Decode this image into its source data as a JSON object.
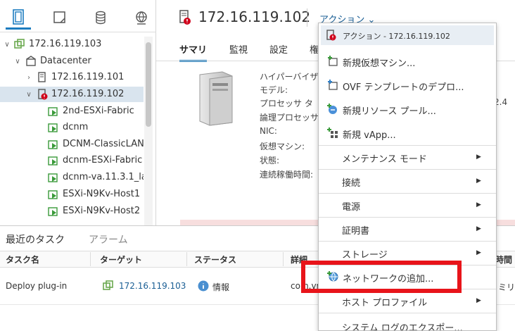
{
  "window": {
    "title": "172.16.119.102",
    "actions_label": "アクション ⌄"
  },
  "nav": {
    "tree": [
      {
        "label": "172.16.119.103",
        "type": "vcenter",
        "expanded": true,
        "depth": 0
      },
      {
        "label": "Datacenter",
        "type": "datacenter",
        "expanded": true,
        "depth": 1
      },
      {
        "label": "172.16.119.101",
        "type": "host",
        "expanded": false,
        "depth": 2
      },
      {
        "label": "172.16.119.102",
        "type": "host-alert",
        "expanded": true,
        "depth": 2,
        "selected": true
      },
      {
        "label": "2nd-ESXi-Fabric",
        "type": "vm",
        "depth": 3
      },
      {
        "label": "dcnm",
        "type": "vm",
        "depth": 3
      },
      {
        "label": "DCNM-ClassicLAN",
        "type": "vm",
        "depth": 3
      },
      {
        "label": "dcnm-ESXi-Fabric",
        "type": "vm",
        "depth": 3
      },
      {
        "label": "dcnm-va.11.3.1_la...",
        "type": "vm",
        "depth": 3
      },
      {
        "label": "ESXi-N9Kv-Host1",
        "type": "vm",
        "depth": 3
      },
      {
        "label": "ESXi-N9Kv-Host2",
        "type": "vm",
        "depth": 3
      }
    ]
  },
  "main": {
    "tabs": [
      "サマリ",
      "監視",
      "設定",
      "権"
    ],
    "summary_labels": [
      "ハイパーバイザ",
      "モデル:",
      "プロセッサ タ",
      "論理プロセッサ",
      "NIC:",
      "仮想マシン:",
      "状態:",
      "連続稼働時間:"
    ],
    "extra_value": "2.4"
  },
  "menu": {
    "header": "アクション - 172.16.119.102",
    "items": [
      {
        "label": "新規仮想マシン...",
        "icon": "new-vm-icon",
        "submenu": false
      },
      {
        "label": "OVF テンプレートのデプロ...",
        "icon": "deploy-ovf-icon",
        "submenu": false
      },
      {
        "label": "新規リソース プール...",
        "icon": "resource-pool-icon",
        "submenu": false
      },
      {
        "label": "新規 vApp...",
        "icon": "vapp-icon",
        "submenu": false
      },
      {
        "label": "メンテナンス モード",
        "submenu": true
      },
      {
        "label": "接続",
        "submenu": true
      },
      {
        "label": "電源",
        "submenu": true
      },
      {
        "label": "証明書",
        "submenu": true
      },
      {
        "label": "ストレージ",
        "submenu": true
      },
      {
        "label": "ネットワークの追加...",
        "icon": "add-network-icon",
        "submenu": false,
        "highlighted": true
      },
      {
        "label": "ホスト プロファイル",
        "submenu": true
      },
      {
        "label": "システム ログのエクスポー...",
        "submenu": false
      }
    ]
  },
  "bottom": {
    "tabs": [
      "最近のタスク",
      "アラーム"
    ],
    "columns": [
      "タスク名",
      "ターゲット",
      "ステータス",
      "詳細",
      "時間"
    ],
    "rows": [
      {
        "task": "Deploy plug-in",
        "target": "172.16.119.103",
        "status": "情報",
        "details": "com.vm",
        "time": "ミリ秒"
      }
    ]
  },
  "colors": {
    "accent": "#1c7cbf",
    "highlight": "#e8141a",
    "vm_green": "#3a9a3a",
    "alert_red": "#d0021b"
  }
}
